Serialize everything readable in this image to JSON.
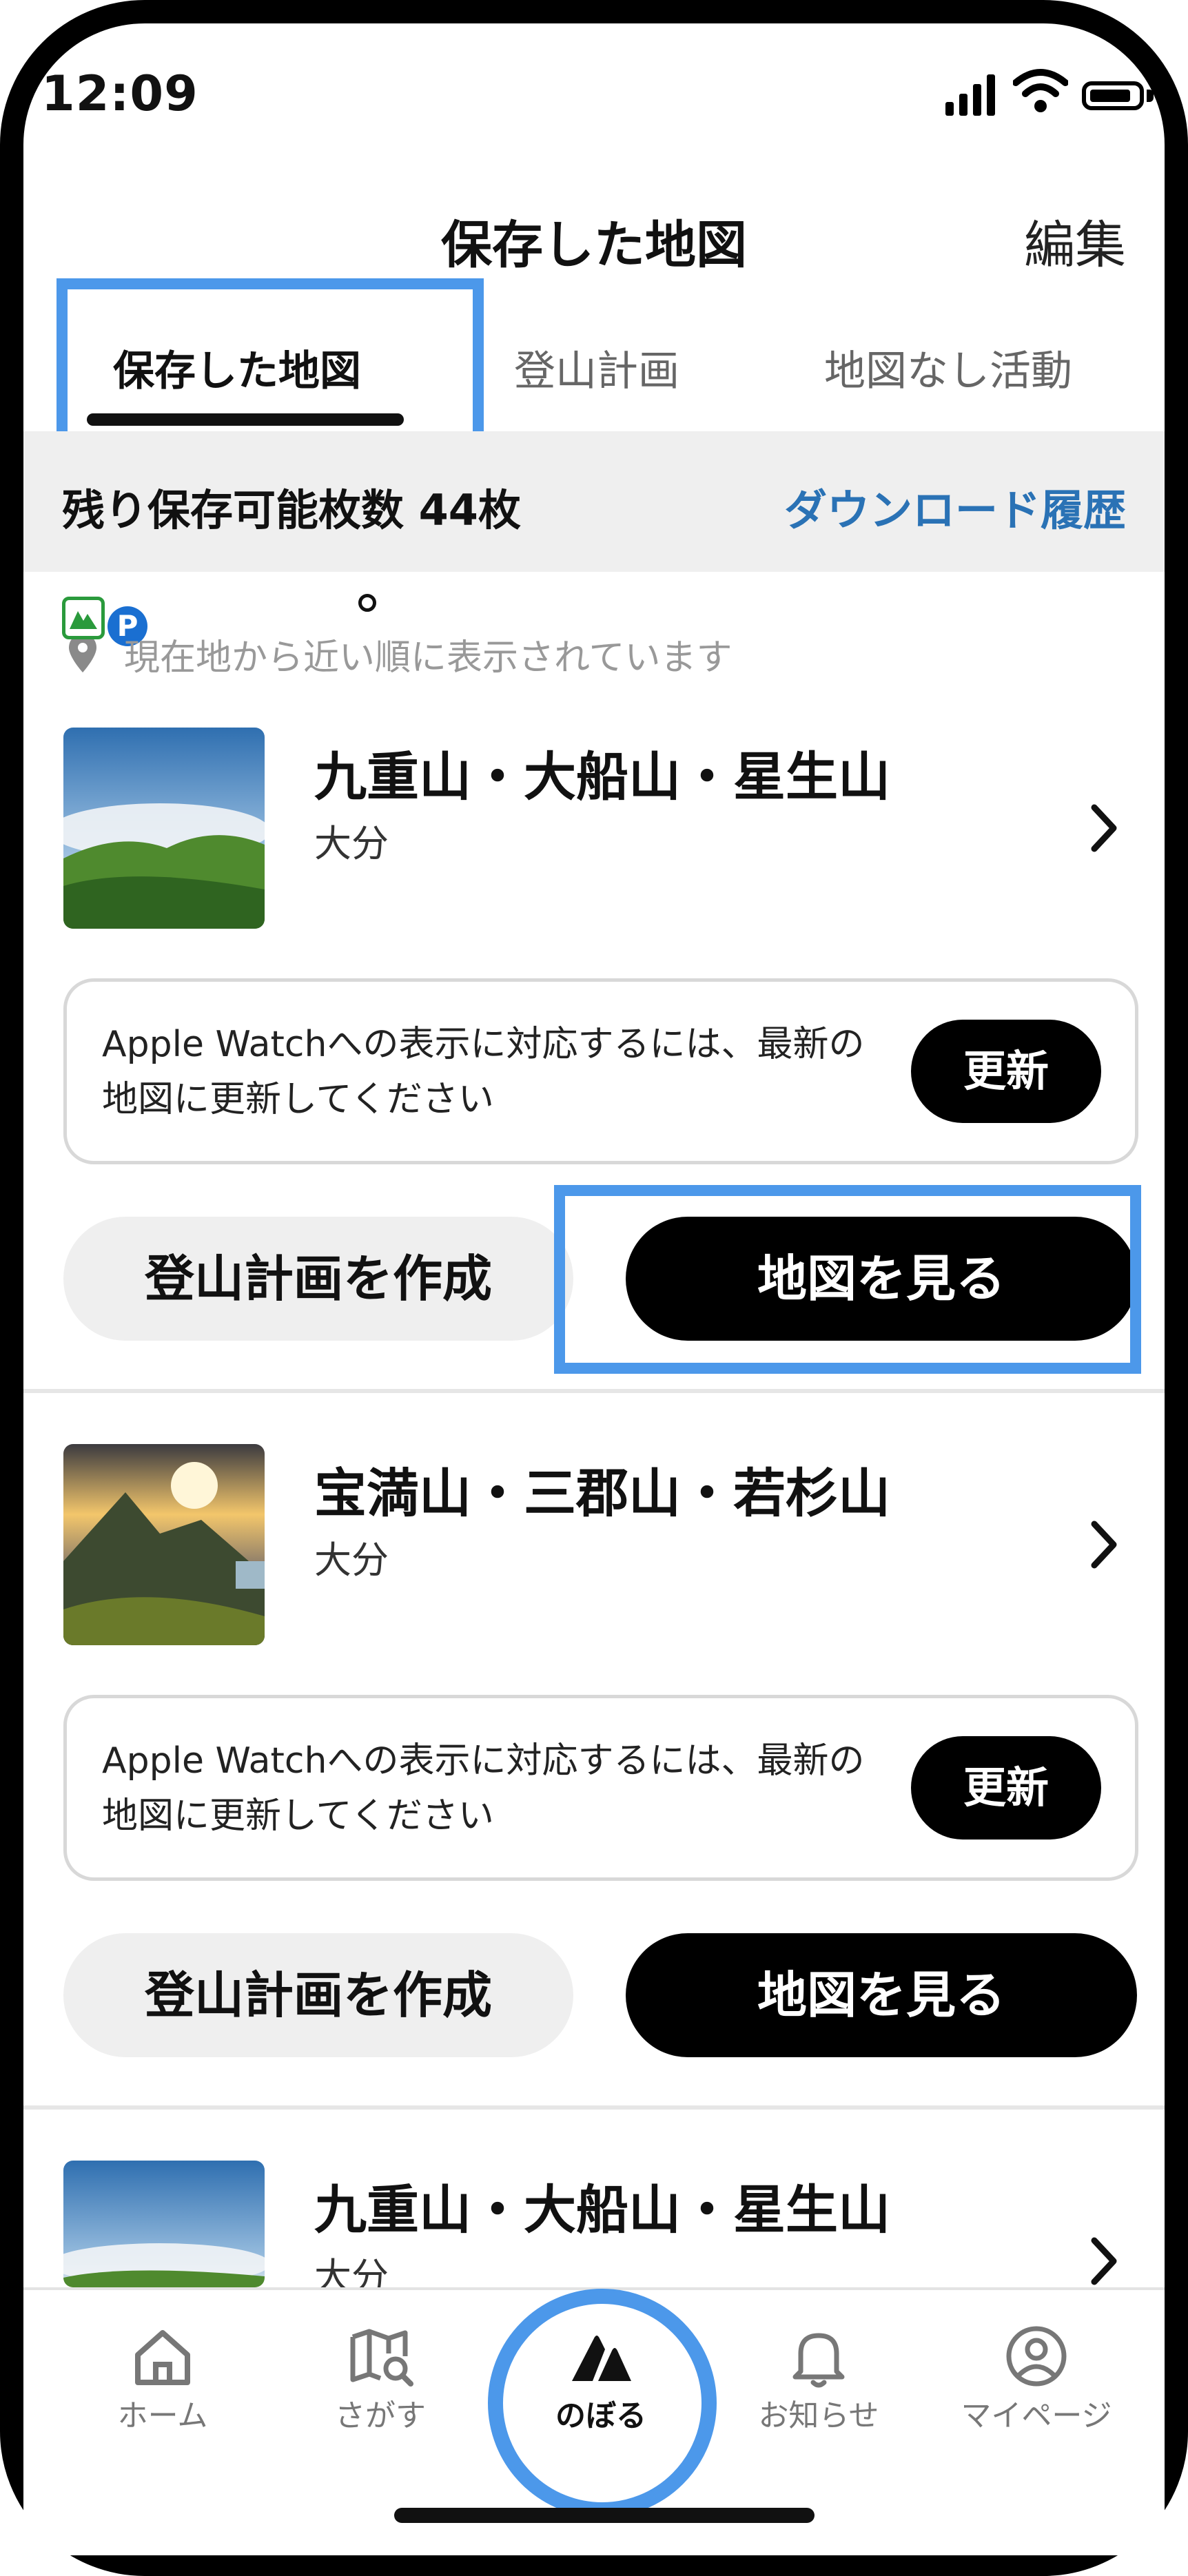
{
  "status_bar": {
    "time": "12:09"
  },
  "header": {
    "title": "保存した地図",
    "edit_label": "編集"
  },
  "tabs": [
    {
      "label": "保存した地図",
      "active": true
    },
    {
      "label": "登山計画",
      "active": false
    },
    {
      "label": "地図なし活動",
      "active": false
    }
  ],
  "quota": {
    "text": "残り保存可能枚数 44枚",
    "history_label": "ダウンロード履歴"
  },
  "sort_hint": "現在地から近い順に表示されています",
  "maps": [
    {
      "name": "九重山・大船山・星生山",
      "prefecture": "大分",
      "notice": "Apple Watchへの表示に対応するには、最新の地図に更新してください",
      "update_label": "更新",
      "plan_label": "登山計画を作成",
      "view_label": "地図を見る"
    },
    {
      "name": "宝満山・三郡山・若杉山",
      "prefecture": "大分",
      "notice": "Apple Watchへの表示に対応するには、最新の地図に更新してください",
      "update_label": "更新",
      "plan_label": "登山計画を作成",
      "view_label": "地図を見る"
    },
    {
      "name": "九重山・大船山・星生山",
      "prefecture": "大分"
    }
  ],
  "tab_bar": [
    {
      "label": "ホーム",
      "icon": "home-icon",
      "active": false
    },
    {
      "label": "さがす",
      "icon": "map-search-icon",
      "active": false
    },
    {
      "label": "のぼる",
      "icon": "climb-icon",
      "active": true
    },
    {
      "label": "お知らせ",
      "icon": "bell-icon",
      "active": false
    },
    {
      "label": "マイページ",
      "icon": "profile-icon",
      "active": false
    }
  ],
  "colors": {
    "highlight": "#4c98ea",
    "link": "#2a72b5",
    "primary": "#000000"
  }
}
